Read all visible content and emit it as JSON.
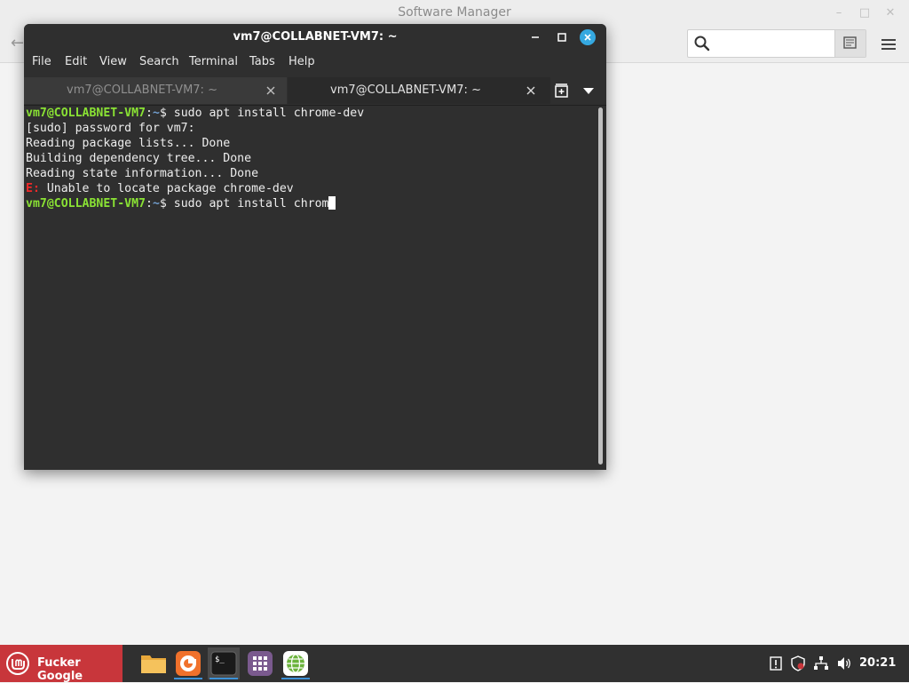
{
  "software_manager": {
    "title": "Software Manager",
    "search": {
      "value": "",
      "placeholder": ""
    }
  },
  "terminal": {
    "title": "vm7@COLLABNET-VM7: ~",
    "menu": [
      "File",
      "Edit",
      "View",
      "Search",
      "Terminal",
      "Tabs",
      "Help"
    ],
    "tabs": [
      {
        "label": "vm7@COLLABNET-VM7: ~",
        "active": false
      },
      {
        "label": "vm7@COLLABNET-VM7: ~",
        "active": true
      }
    ],
    "lines": [
      {
        "type": "prompt",
        "user": "vm7@COLLABNET-VM7",
        "path": "~",
        "symbol": "$",
        "command": " sudo apt install chrome-dev"
      },
      {
        "type": "text",
        "text": "[sudo] password for vm7:"
      },
      {
        "type": "text",
        "text": "Reading package lists... Done"
      },
      {
        "type": "text",
        "text": "Building dependency tree... Done"
      },
      {
        "type": "text",
        "text": "Reading state information... Done"
      },
      {
        "type": "error",
        "prefix": "E:",
        "text": " Unable to locate package chrome-dev"
      },
      {
        "type": "prompt",
        "user": "vm7@COLLABNET-VM7",
        "path": "~",
        "symbol": "$",
        "command": " sudo apt install chrom"
      }
    ]
  },
  "taskbar": {
    "menu_label": "Fucker Google",
    "apps": [
      "files-icon",
      "firefox-icon",
      "terminal-icon",
      "apps-grid-icon",
      "network-globe-icon"
    ],
    "clock": "20:21"
  },
  "colors": {
    "accent": "#35a8e0",
    "menu_red": "#c8363b",
    "prompt_green": "#8ae234",
    "prompt_blue": "#729fcf",
    "error_red": "#ef2929"
  }
}
